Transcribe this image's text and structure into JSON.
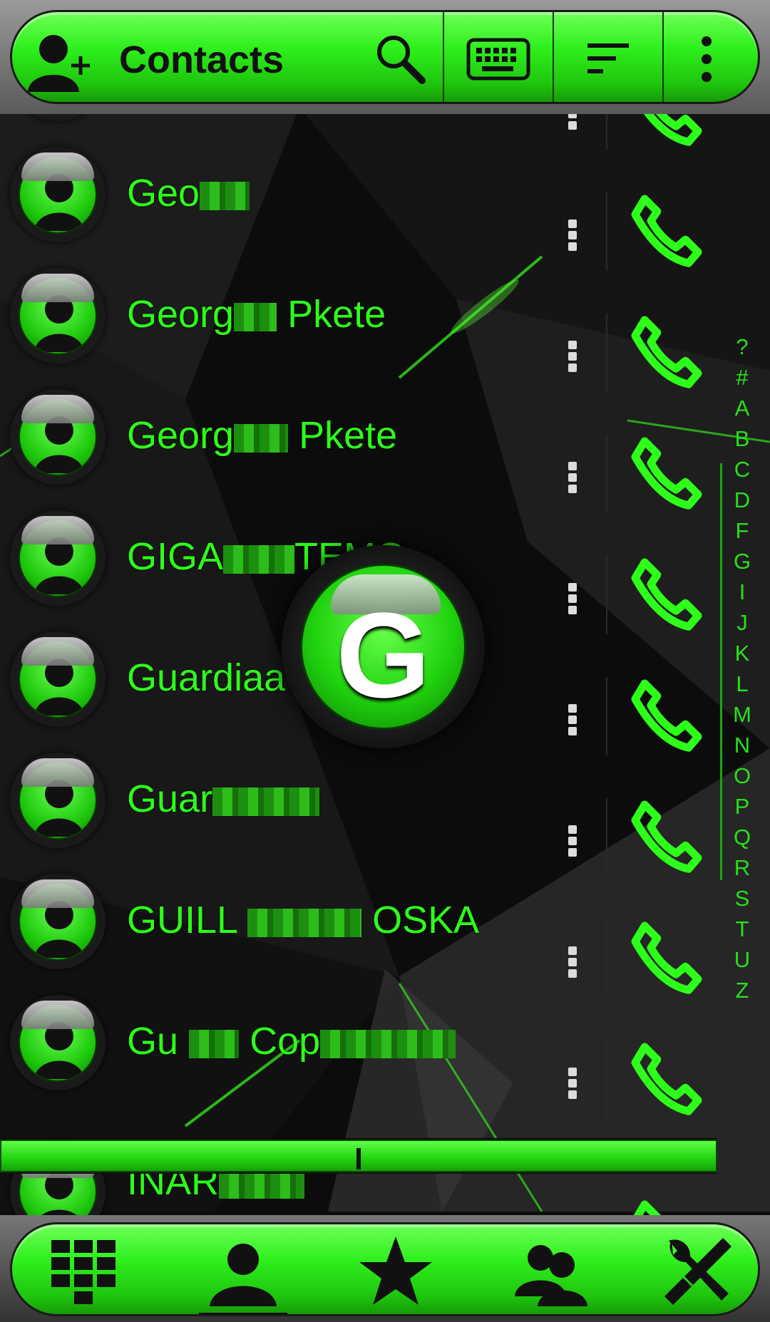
{
  "header": {
    "title": "Contacts",
    "add_contact_icon": "add-contact-icon",
    "search_icon": "search-icon",
    "keyboard_icon": "keyboard-icon",
    "sort_icon": "sort-icon",
    "overflow_icon": "more-vertical-icon"
  },
  "contacts": [
    {
      "visible_name": "",
      "partial": true
    },
    {
      "visible_name": "Geo",
      "hidden_tail": true
    },
    {
      "visible_name_a": "Georg",
      "visible_name_b": "Pkete"
    },
    {
      "visible_name_a": "Georg",
      "visible_name_b": "Pkete"
    },
    {
      "visible_name_a": "GIGA",
      "visible_name_b": "TEMO"
    },
    {
      "visible_name": "Guardiaa"
    },
    {
      "visible_name": "Guar",
      "hidden_tail": true
    },
    {
      "visible_name_a": "GUILL",
      "visible_name_b": "OSKA"
    },
    {
      "visible_name_a": "Gu",
      "visible_name_b": "Cop"
    },
    {
      "visible_name": "INAR",
      "partial": true
    }
  ],
  "section_bubble": {
    "letter": "G"
  },
  "alphabet_index": [
    "?",
    "#",
    "A",
    "B",
    "C",
    "D",
    "F",
    "G",
    "I",
    "J",
    "K",
    "L",
    "M",
    "N",
    "O",
    "P",
    "Q",
    "R",
    "S",
    "T",
    "U",
    "Z"
  ],
  "scroll_position": 0.5,
  "bottom_nav": {
    "items": [
      {
        "icon": "dialpad-icon",
        "active": false
      },
      {
        "icon": "contacts-icon",
        "active": true
      },
      {
        "icon": "favorites-star-icon",
        "active": false
      },
      {
        "icon": "groups-icon",
        "active": false
      },
      {
        "icon": "settings-tools-icon",
        "active": false
      }
    ]
  },
  "colors": {
    "accent": "#2dff1a",
    "background": "#000000"
  }
}
